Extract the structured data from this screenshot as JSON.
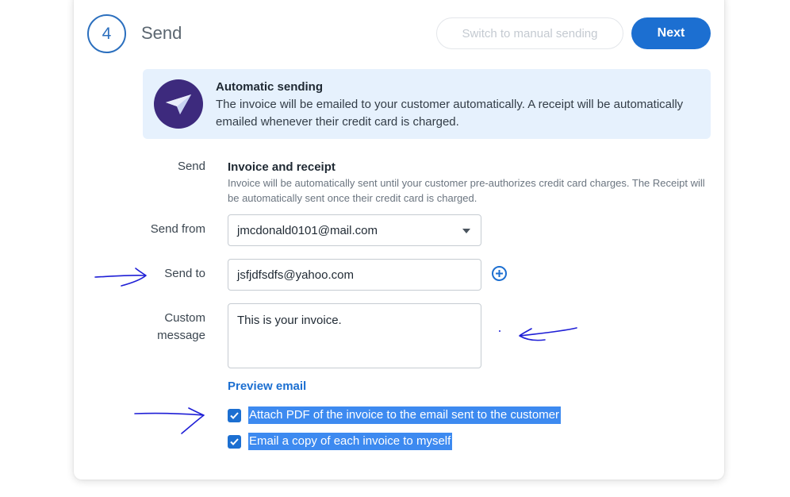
{
  "header": {
    "step_number": "4",
    "step_title": "Send",
    "switch_button_label": "Switch to manual sending",
    "next_button_label": "Next"
  },
  "info": {
    "title": "Automatic sending",
    "text": "The invoice will be emailed to your customer automatically. A receipt will be automatically emailed whenever their credit card is charged.",
    "icon": "paper-plane-icon"
  },
  "form": {
    "send_label": "Send",
    "send_heading": "Invoice and receipt",
    "send_description": "Invoice will be automatically sent until your customer pre-authorizes credit card charges. The Receipt will be automatically sent once their credit card is charged.",
    "send_from_label": "Send from",
    "send_from_value": "jmcdonald0101@mail.com",
    "send_to_label": "Send to",
    "send_to_value": "jsfjdfsdfs@yahoo.com",
    "custom_message_label_line1": "Custom",
    "custom_message_label_line2": "message",
    "custom_message_value": "This is your invoice.",
    "preview_link": "Preview email"
  },
  "options": [
    {
      "label": "Attach PDF of the invoice to the email sent to the customer",
      "checked": true
    },
    {
      "label": "Email a copy of each invoice to myself",
      "checked": true
    }
  ],
  "colors": {
    "accent": "#1c6fd1",
    "info_background": "#e6f1fd",
    "badge": "#3d2a7d",
    "selection": "#3d8af0",
    "annotation_ink": "#1f1fd6"
  }
}
